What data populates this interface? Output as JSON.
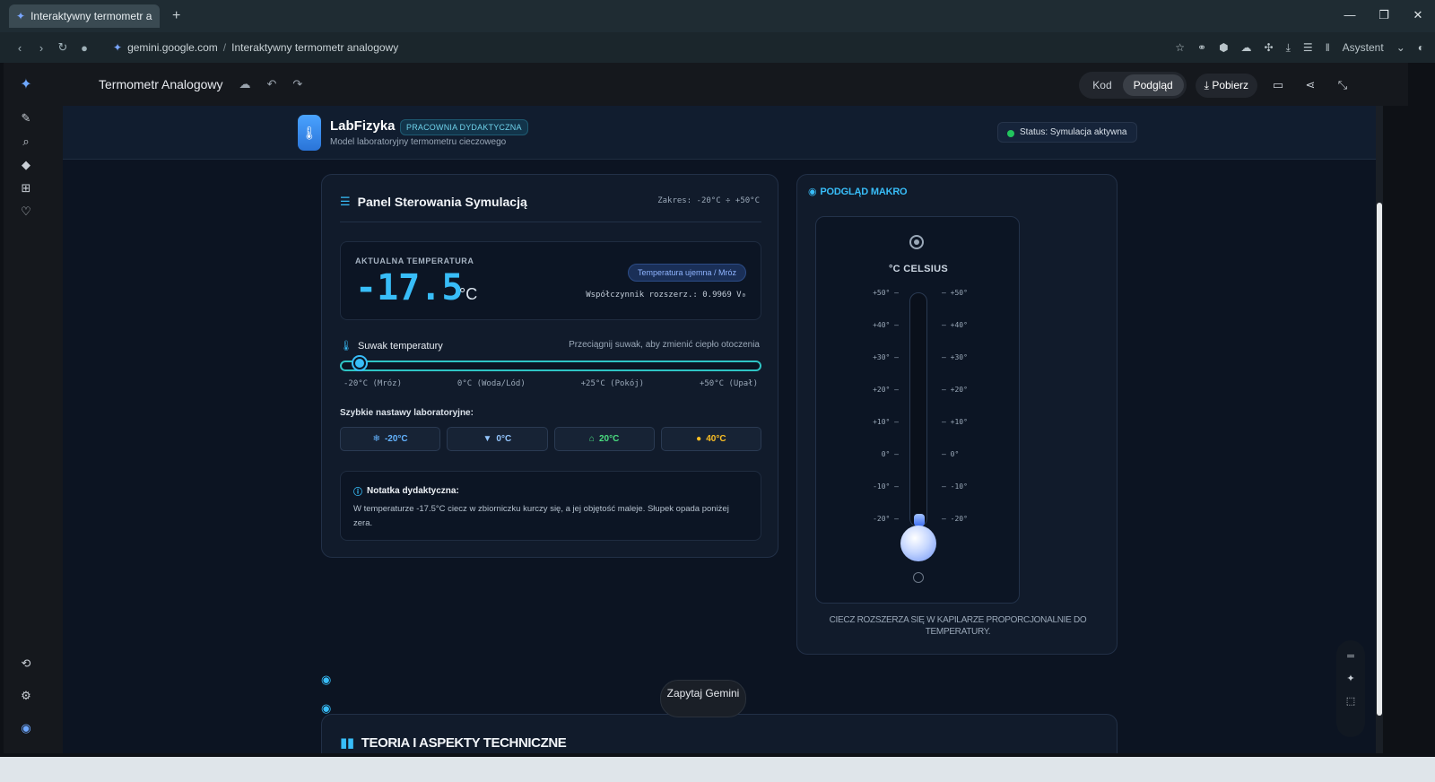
{
  "browser": {
    "tab_title": "Interaktywny termometr a",
    "url_domain": "gemini.google.com",
    "url_path": "Interaktywny termometr analogowy",
    "assistant_label": "Asystent"
  },
  "app": {
    "title": "Termometr Analogowy",
    "view_code": "Kod",
    "view_preview": "Podgląd",
    "download": "Pobierz"
  },
  "lab": {
    "brand": "LabFizyka",
    "pill": "PRACOWNIA DYDAKTYCZNA",
    "subtitle": "Model laboratoryjny termometru cieczowego",
    "status": "Status: Symulacja aktywna"
  },
  "panel": {
    "title": "Panel Sterowania Symulacją",
    "range": "Zakres: -20°C ÷ +50°C",
    "temp_label": "AKTUALNA TEMPERATURA",
    "temp_value": "-17.5",
    "temp_unit": "°C",
    "badge": "Temperatura ujemna / Mróz",
    "coef": "Współczynnik rozszerz.: 0.9969 V₀",
    "slider_label": "Suwak temperatury",
    "slider_hint": "Przeciągnij suwak, aby zmienić ciepło otoczenia",
    "slider_value": -17.5,
    "slider_min": -20,
    "slider_max": 50,
    "ticks": [
      "-20°C (Mróz)",
      "0°C (Woda/Lód)",
      "+25°C (Pokój)",
      "+50°C (Upał)"
    ],
    "quick_label": "Szybkie nastawy laboratoryjne:",
    "presets": [
      "-20°C",
      "0°C",
      "20°C",
      "40°C"
    ],
    "note_title": "Notatka dydaktyczna:",
    "note_text": "W temperaturze -17.5°C ciecz w zbiorniczku kurczy się, a jej objętość maleje. Słupek opada poniżej zera."
  },
  "macro": {
    "title": "PODGLĄD MAKRO",
    "unit_label": "°C CELSIUS",
    "scale_left": [
      "+50° —",
      "+40° —",
      "+30° —",
      "+20° —",
      "+10° —",
      "0° —",
      "-10° —",
      "-20° —"
    ],
    "scale_right": [
      "— +50°",
      "— +40°",
      "— +30°",
      "— +20°",
      "— +10°",
      "— 0°",
      "— -10°",
      "— -20°"
    ],
    "caption": "CIECZ ROZSZERZA SIĘ W KAPILARZE PROPORCJONALNIE DO TEMPERATURY."
  },
  "footer": {
    "ask_gemini": "Zapytaj Gemini",
    "theory_title": "TEORIA I ASPEKTY TECHNICZNE"
  },
  "colors": {
    "accent": "#38bdf8",
    "status_ok": "#22c55e",
    "preset_cold": "#63b3ff",
    "preset_room": "#4ade80",
    "preset_hot": "#fbbf24"
  }
}
